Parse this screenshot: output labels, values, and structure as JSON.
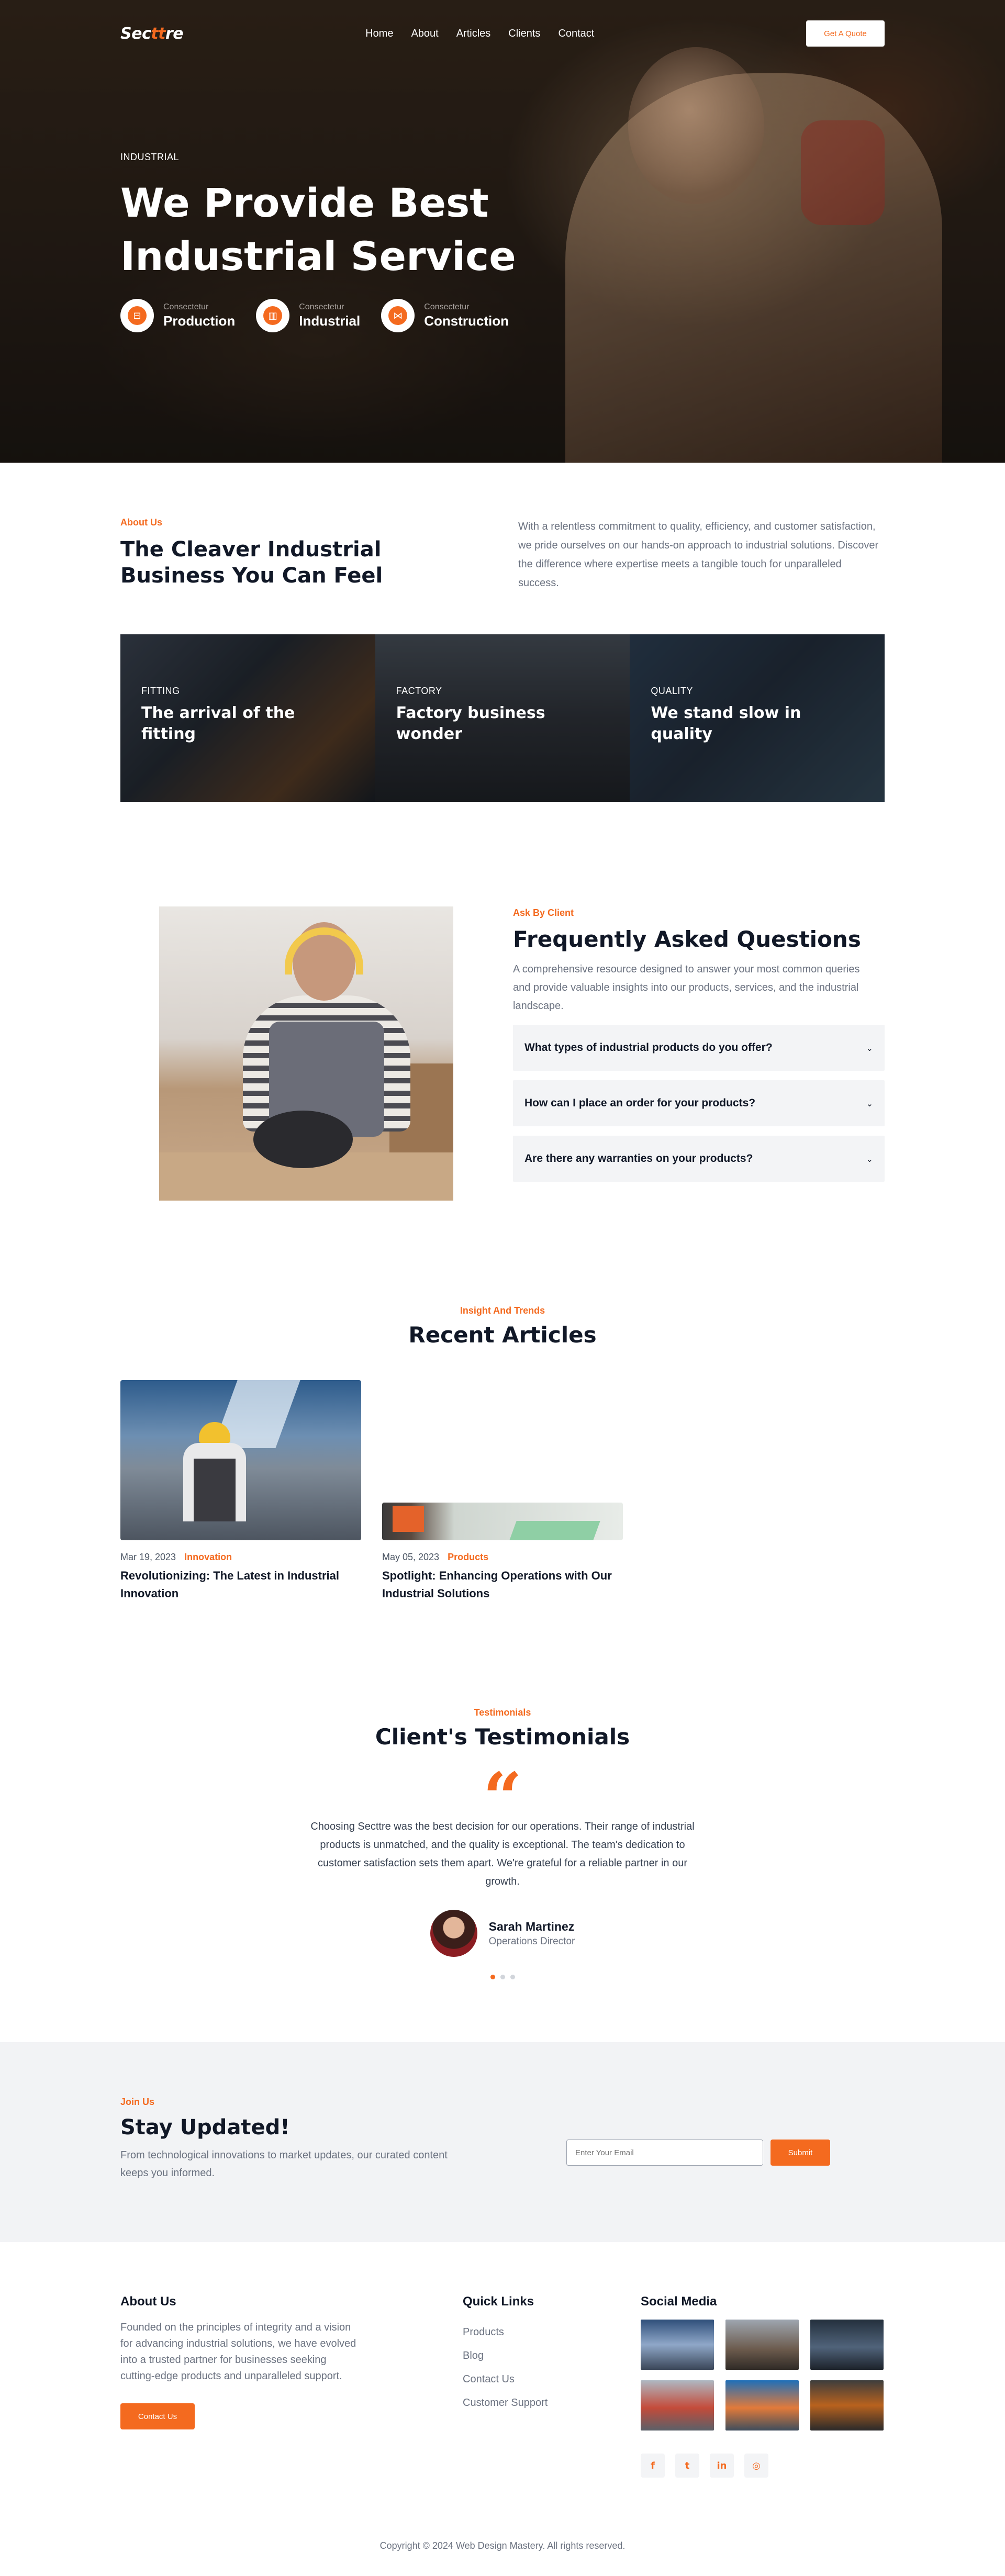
{
  "brand": {
    "logo_a": "Sec",
    "logo_b": "tt",
    "logo_c": "re",
    "accent": "#f46a1f"
  },
  "nav": {
    "items": [
      "Home",
      "About",
      "Articles",
      "Clients",
      "Contact"
    ],
    "cta": "Get A Quote"
  },
  "hero": {
    "eyebrow": "INDUSTRIAL",
    "title": "We Provide Best Industrial Service",
    "features": [
      {
        "sub": "Consectetur",
        "title": "Production",
        "icon": "production-icon"
      },
      {
        "sub": "Consectetur",
        "title": "Industrial",
        "icon": "factory-icon"
      },
      {
        "sub": "Consectetur",
        "title": "Construction",
        "icon": "network-icon"
      }
    ]
  },
  "about": {
    "eyebrow": "About Us",
    "title": "The Cleaver Industrial Business You Can Feel",
    "text": "With a relentless commitment to quality, efficiency, and customer satisfaction, we pride ourselves on our hands-on approach to industrial solutions. Discover the difference where expertise meets a tangible touch for unparalleled success.",
    "cards": [
      {
        "tag": "FITTING",
        "title": "The arrival of the fitting"
      },
      {
        "tag": "FACTORY",
        "title": "Factory business wonder"
      },
      {
        "tag": "QUALITY",
        "title": "We stand slow in quality"
      }
    ]
  },
  "faq": {
    "eyebrow": "Ask By Client",
    "title": "Frequently Asked Questions",
    "text": "A comprehensive resource designed to answer your most common queries and provide valuable insights into our products, services, and the industrial landscape.",
    "items": [
      "What types of industrial products do you offer?",
      "How can I place an order for your products?",
      "Are there any warranties on your products?"
    ]
  },
  "articles": {
    "eyebrow": "Insight And Trends",
    "title": "Recent Articles",
    "items": [
      {
        "date": "Mar 19, 2023",
        "category": "Innovation",
        "title": "Revolutionizing: The Latest in Industrial Innovation"
      },
      {
        "date": "May 05, 2023",
        "category": "Products",
        "title": "Spotlight: Enhancing Operations with Our Industrial Solutions"
      }
    ]
  },
  "testimonials": {
    "eyebrow": "Testimonials",
    "title": "Client's Testimonials",
    "quote": "Choosing Secttre was the best decision for our operations. Their range of industrial products is unmatched, and the quality is exceptional. The team's dedication to customer satisfaction sets them apart. We're grateful for a reliable partner in our growth.",
    "name": "Sarah Martinez",
    "role": "Operations Director"
  },
  "newsletter": {
    "eyebrow": "Join Us",
    "title": "Stay Updated!",
    "text": "From technological innovations to market updates, our curated content keeps you informed.",
    "placeholder": "Enter Your Email",
    "submit": "Submit"
  },
  "footer": {
    "about_title": "About Us",
    "about_text": "Founded on the principles of integrity and a vision for advancing industrial solutions, we have evolved into a trusted partner for businesses seeking cutting-edge products and unparalleled support.",
    "contact_btn": "Contact Us",
    "links_title": "Quick Links",
    "links": [
      "Products",
      "Blog",
      "Contact Us",
      "Customer Support"
    ],
    "social_title": "Social Media",
    "social_icons": [
      "facebook-icon",
      "twitter-icon",
      "linkedin-icon",
      "instagram-icon"
    ],
    "social_glyphs": [
      "f",
      "t",
      "in",
      "◎"
    ],
    "copyright": "Copyright © 2024 Web Design Mastery. All rights reserved."
  }
}
